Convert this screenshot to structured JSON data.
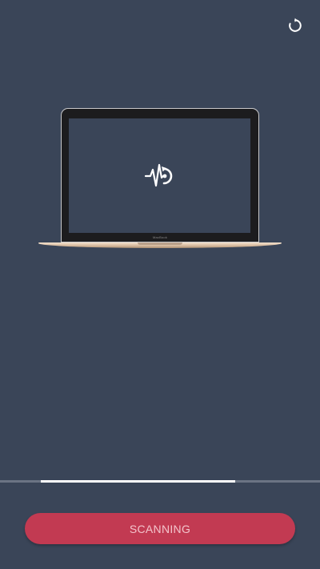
{
  "header": {
    "refresh_icon": "refresh-icon"
  },
  "device": {
    "brand_label": "MacBook",
    "logo_icon": "heartbeat-refresh-logo-icon"
  },
  "progress": {
    "start_fraction": 0.128,
    "end_fraction": 0.735
  },
  "action": {
    "button_label": "SCANNING"
  },
  "colors": {
    "background": "#3a4558",
    "accent": "#c23a52",
    "button_text": "#f3c4cc",
    "progress_fill": "#ffffff",
    "progress_track": "#6b7484"
  }
}
